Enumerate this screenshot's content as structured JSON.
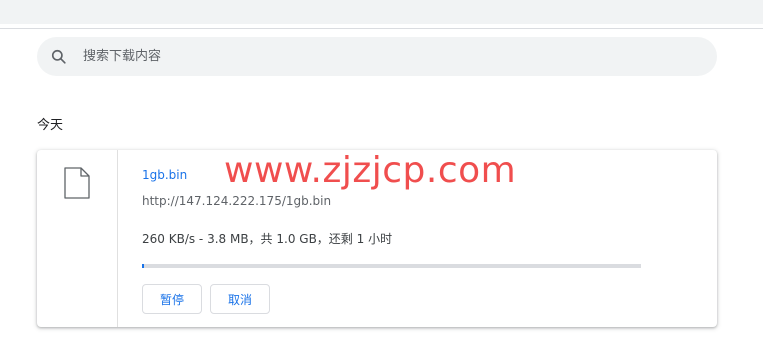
{
  "search": {
    "placeholder": "搜索下载内容",
    "icon": "search-icon"
  },
  "section": {
    "date_label": "今天"
  },
  "download": {
    "file_name": "1gb.bin",
    "url": "http://147.124.222.175/1gb.bin",
    "status": "260 KB/s - 3.8 MB，共 1.0 GB，还剩 1 小时",
    "progress_fraction": 0.0037,
    "pause_label": "暂停",
    "cancel_label": "取消",
    "file_icon": "file-icon"
  },
  "watermark": {
    "text": "www.zjzjcp.com"
  },
  "colors": {
    "accent": "#1a73e8",
    "watermark": "#f04e4e",
    "track": "#dadce0",
    "search_bg": "#f1f3f4"
  }
}
